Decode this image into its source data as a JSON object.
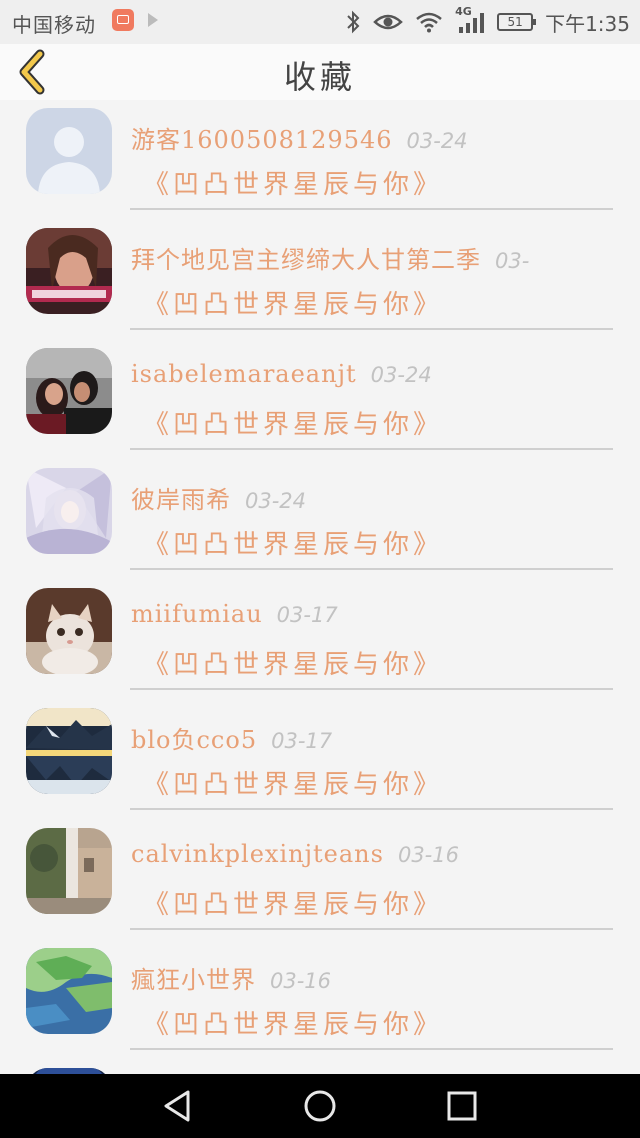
{
  "status_bar": {
    "carrier": "中国移动",
    "network": "4G",
    "battery": "51",
    "time": "下午1:35"
  },
  "header": {
    "title": "收藏"
  },
  "colors": {
    "accent": "#e8a076",
    "date": "#c2c2c2",
    "divider": "#cfcfcf"
  },
  "favorites": [
    {
      "user": "游客1600508129546",
      "date": "03-24",
      "title": "《凹凸世界星辰与你》",
      "avatar": "default-avatar-icon"
    },
    {
      "user": "拜个地见宫主缪缔大人甘第二季",
      "date": "03-",
      "title": "《凹凸世界星辰与你》",
      "avatar": "user-photo"
    },
    {
      "user": "isabelemaraeanjt",
      "date": "03-24",
      "title": "《凹凸世界星辰与你》",
      "avatar": "user-photo"
    },
    {
      "user": "彼岸雨希",
      "date": "03-24",
      "title": "《凹凸世界星辰与你》",
      "avatar": "user-photo"
    },
    {
      "user": "miifumiau",
      "date": "03-17",
      "title": "《凹凸世界星辰与你》",
      "avatar": "cat-photo"
    },
    {
      "user": "blo负cco5",
      "date": "03-17",
      "title": "《凹凸世界星辰与你》",
      "avatar": "landscape-photo"
    },
    {
      "user": "calvinkplexinjteans",
      "date": "03-16",
      "title": "《凹凸世界星辰与你》",
      "avatar": "street-photo"
    },
    {
      "user": "瘋狂小世界",
      "date": "03-16",
      "title": "《凹凸世界星辰与你》",
      "avatar": "map-photo"
    }
  ],
  "nav_bar": {
    "items": [
      "back-nav-icon",
      "home-nav-icon",
      "recents-nav-icon"
    ]
  }
}
